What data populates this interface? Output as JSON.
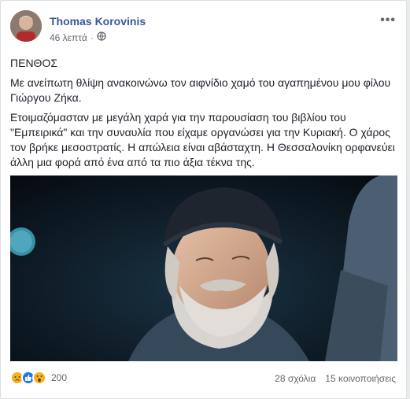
{
  "post": {
    "author": "Thomas Korovinis",
    "time": "46 λεπτά",
    "more_label": "•••",
    "paragraphs": [
      "ΠΕΝΘΟΣ",
      "Με ανείπωτη θλίψη ανακοινώνω τον αιφνίδιο χαμό του αγαπημένου μου φίλου Γιώργου Ζήκα.",
      "Ετοιμαζόμασταν με μεγάλη χαρά για την παρουσίαση του βιβλίου του \"Εμπειρικά\" και την συναυλία που είχαμε οργανώσει για την Κυριακή. Ο χάρος τον βρήκε μεσοστρατίς. Η απώλεια είναι αβάσταχτη. Η Θεσσαλονίκη ορφανεύει άλλη μια φορά από ένα από τα πιο άξια τέκνα της."
    ]
  },
  "footer": {
    "reaction_count": "200",
    "comments": "28 σχόλια",
    "shares": "15 κοινοποιήσεις"
  },
  "colors": {
    "author_link": "#385898",
    "like_blue": "#1877f2",
    "sad_yellow": "#f7b125"
  },
  "icons": {
    "privacy": "globe-icon",
    "reactions": [
      "sad-reaction-icon",
      "like-reaction-icon",
      "wow-reaction-icon"
    ]
  }
}
